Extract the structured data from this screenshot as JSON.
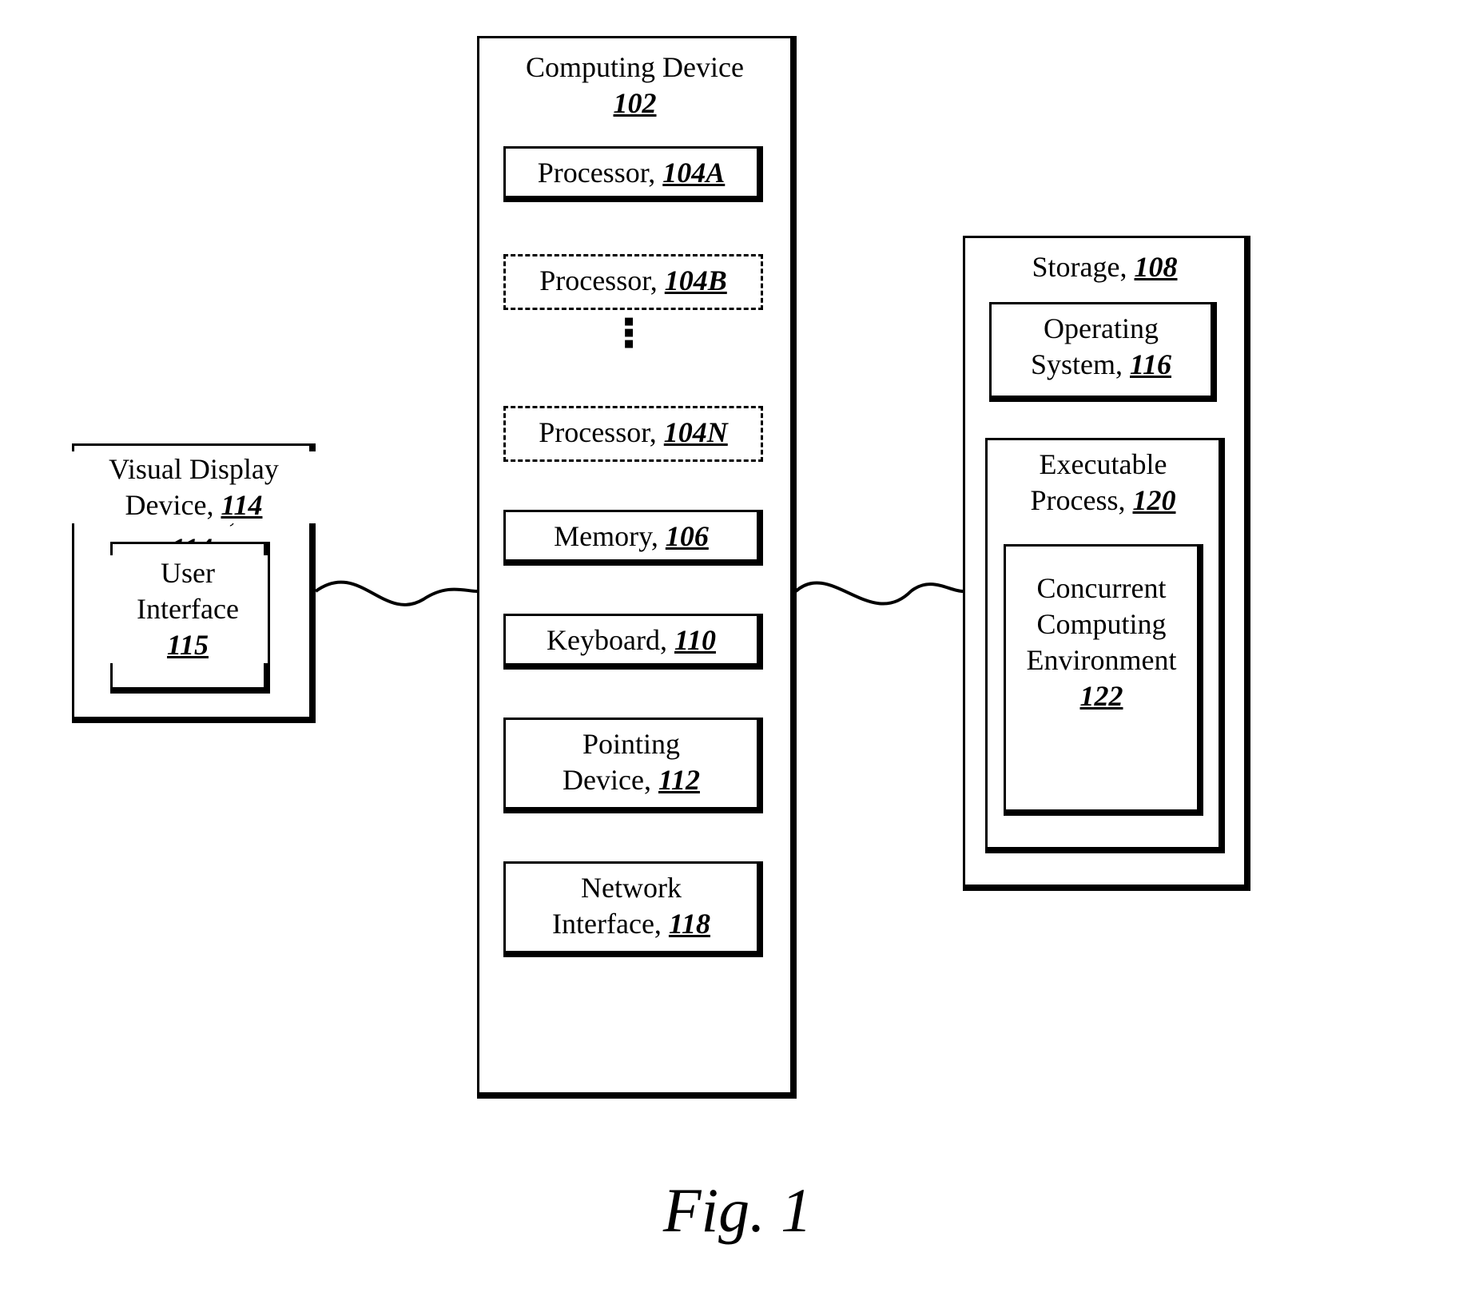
{
  "figure_label": "Fig. 1",
  "visual_display": {
    "title": "Visual Display Device,",
    "ref": "114",
    "ui_title": "User Interface",
    "ui_ref": "115"
  },
  "computing_device": {
    "title": "Computing Device",
    "ref": "102",
    "proc_a": {
      "label": "Processor,",
      "ref": "104A"
    },
    "proc_b": {
      "label": "Processor,",
      "ref": "104B"
    },
    "proc_n": {
      "label": "Processor,",
      "ref": "104N"
    },
    "memory": {
      "label": "Memory,",
      "ref": "106"
    },
    "keyboard": {
      "label": "Keyboard,",
      "ref": "110"
    },
    "pointing_label1": "Pointing",
    "pointing_label2": "Device,",
    "pointing_ref": "112",
    "net_label1": "Network",
    "net_label2": "Interface,",
    "net_ref": "118"
  },
  "storage": {
    "title": "Storage,",
    "ref": "108",
    "os_label1": "Operating",
    "os_label2": "System,",
    "os_ref": "116",
    "exec_label1": "Executable",
    "exec_label2": "Process,",
    "exec_ref": "120",
    "env_label1": "Concurrent",
    "env_label2": "Computing",
    "env_label3": "Environment",
    "env_ref": "122"
  }
}
